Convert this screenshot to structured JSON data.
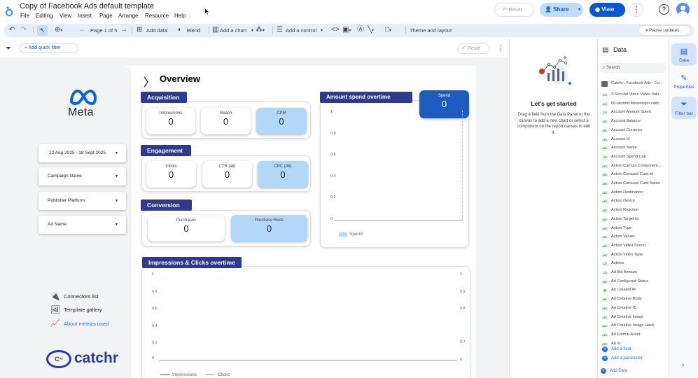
{
  "app": {
    "title": "Copy of Facebook Ads default template",
    "menus": [
      "File",
      "Editing",
      "View",
      "Insert",
      "Page",
      "Arrange",
      "Resource",
      "Help"
    ],
    "reset": "Reset",
    "share": "Share",
    "view": "View"
  },
  "toolbar": {
    "page": "Page 1 of 5",
    "add_data": "Add data",
    "blend": "Blend",
    "add_chart": "Add a chart",
    "add_control": "Add a control",
    "theme": "Theme and layout",
    "pause": "Pause updates"
  },
  "filterbar": {
    "add_filter": "+ Add quick filter",
    "reset": "Reset"
  },
  "report": {
    "heading": "Overview",
    "brand": "Meta",
    "filters": [
      "22 Aug 2025 - 18 Sept 2025",
      "Campaign Name",
      "Publisher Platform",
      "Ad Name"
    ],
    "links": [
      "Connectors list",
      "Template gallery",
      "About metrics used"
    ],
    "footer_brand": "catchr",
    "sections": {
      "acquisition": {
        "title": "Acquisition",
        "cards": [
          {
            "label": "Impressions",
            "value": "0"
          },
          {
            "label": "Reach",
            "value": "0"
          },
          {
            "label": "CPM",
            "value": "0"
          }
        ]
      },
      "engagement": {
        "title": "Engagement",
        "cards": [
          {
            "label": "Clicks",
            "value": "0"
          },
          {
            "label": "CTR (all)",
            "value": "0"
          },
          {
            "label": "CPC (All)",
            "value": "0"
          }
        ]
      },
      "conversion": {
        "title": "Conversion",
        "cards": [
          {
            "label": "Purchases",
            "value": "0"
          },
          {
            "label": "Purchase Roas",
            "value": "0"
          }
        ]
      }
    },
    "spend_card": {
      "label": "Spend",
      "value": "0"
    }
  },
  "chart_data": [
    {
      "type": "line",
      "title": "Amount spend overtime",
      "y_ticks": [
        "1",
        "0.8",
        "0.6",
        "0.4",
        "0.2",
        "0"
      ],
      "ylim": [
        0,
        1
      ],
      "series": [
        {
          "name": "Spend",
          "values": []
        }
      ],
      "colors": {
        "Spend": "#b3d7f7"
      }
    },
    {
      "type": "line",
      "title": "Impressions & Clicks overtime",
      "y_ticks": [
        "1",
        "0.8",
        "0.6",
        "0.4",
        "0.2",
        "0"
      ],
      "y2_ticks": [
        "1",
        "0.9",
        "0.8",
        "0.7",
        "0"
      ],
      "series": [
        {
          "name": "Impressions",
          "values": []
        },
        {
          "name": "Clicks",
          "values": []
        }
      ],
      "colors": {
        "Impressions": "#1f3a8a",
        "Clicks": "#4a90e2"
      }
    }
  ],
  "gsp": {
    "title": "Let's get started",
    "body": "Drag a field from the Data Panel to the canvas to add a new chart or select a component on the report canvas to edit it."
  },
  "datapanel": {
    "title": "Data",
    "search": "Search",
    "source": "Catchr - Facebook Ads - Co...",
    "fields": [
      {
        "t": "123",
        "n": "3-Second Video Views Valu..."
      },
      {
        "t": "123",
        "n": "60-second Messenger calls"
      },
      {
        "t": "123",
        "n": "Account Amount Spent"
      },
      {
        "t": "ABC",
        "n": "Account Balance"
      },
      {
        "t": "ABC",
        "n": "Account Currency"
      },
      {
        "t": "ABC",
        "n": "Account Id"
      },
      {
        "t": "ABC",
        "n": "Account Name"
      },
      {
        "t": "123",
        "n": "Account Spend Cap"
      },
      {
        "t": "ABC",
        "n": "Action Canvas Component..."
      },
      {
        "t": "ABC",
        "n": "Action Carousel Card Id"
      },
      {
        "t": "ABC",
        "n": "Action Carousel Card Name"
      },
      {
        "t": "ABC",
        "n": "Action Destination"
      },
      {
        "t": "ABC",
        "n": "Action Device"
      },
      {
        "t": "ABC",
        "n": "Action Reaction"
      },
      {
        "t": "ABC",
        "n": "Action Target Id"
      },
      {
        "t": "ABC",
        "n": "Action Type"
      },
      {
        "t": "ABC",
        "n": "Action Values"
      },
      {
        "t": "ABC",
        "n": "Action Video Sound"
      },
      {
        "t": "ABC",
        "n": "Action Video Type"
      },
      {
        "t": "123",
        "n": "Actions"
      },
      {
        "t": "123",
        "n": "Ad Bid Amount"
      },
      {
        "t": "ABC",
        "n": "Ad Configured Status"
      },
      {
        "t": "CAL",
        "n": "Ad Created At"
      },
      {
        "t": "ABC",
        "n": "Ad Creative Body"
      },
      {
        "t": "ABC",
        "n": "Ad Creative ID"
      },
      {
        "t": "ABC",
        "n": "Ad Creative Image"
      },
      {
        "t": "ABC",
        "n": "Ad Creative Image Hash"
      },
      {
        "t": "ABC",
        "n": "Ad Format Asset"
      },
      {
        "t": "ABC",
        "n": "Ad Id"
      }
    ],
    "add_field": "Add a field",
    "add_param": "Add a parameter",
    "add_data": "Add Data"
  },
  "rail": {
    "data": "Data",
    "properties": "Properties",
    "filter": "Filter bar"
  }
}
